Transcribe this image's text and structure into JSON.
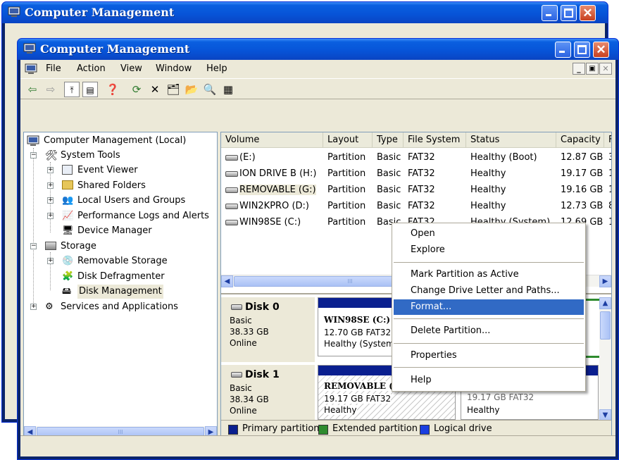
{
  "back_window": {
    "title": "Computer Management"
  },
  "window": {
    "title": "Computer Management",
    "menu": [
      "File",
      "Action",
      "View",
      "Window",
      "Help"
    ]
  },
  "tree": {
    "root": "Computer Management (Local)",
    "items": [
      "System Tools",
      "Event Viewer",
      "Shared Folders",
      "Local Users and Groups",
      "Performance Logs and Alerts",
      "Device Manager",
      "Storage",
      "Removable Storage",
      "Disk Defragmenter",
      "Disk Management",
      "Services and Applications"
    ]
  },
  "volumes": {
    "columns": [
      "Volume",
      "Layout",
      "Type",
      "File System",
      "Status",
      "Capacity",
      "F"
    ],
    "rows": [
      {
        "volume": "(E:)",
        "layout": "Partition",
        "type": "Basic",
        "fs": "FAT32",
        "status": "Healthy (Boot)",
        "capacity": "12.87 GB",
        "free": "3"
      },
      {
        "volume": "ION DRIVE B (H:)",
        "layout": "Partition",
        "type": "Basic",
        "fs": "FAT32",
        "status": "Healthy",
        "capacity": "19.17 GB",
        "free": "1"
      },
      {
        "volume": "REMOVABLE (G:)",
        "layout": "Partition",
        "type": "Basic",
        "fs": "FAT32",
        "status": "Healthy",
        "capacity": "19.16 GB",
        "free": "1"
      },
      {
        "volume": "WIN2KPRO (D:)",
        "layout": "Partition",
        "type": "Basic",
        "fs": "FAT32",
        "status": "Healthy",
        "capacity": "12.73 GB",
        "free": "8"
      },
      {
        "volume": "WIN98SE (C:)",
        "layout": "Partition",
        "type": "Basic",
        "fs": "FAT32",
        "status": "Healthy (System)",
        "capacity": "12.69 GB",
        "free": "1"
      }
    ]
  },
  "disks": [
    {
      "name": "Disk 0",
      "type": "Basic",
      "size": "38.33 GB",
      "state": "Online",
      "partition": {
        "name": "WIN98SE (C:)",
        "size": "12.70 GB FAT32",
        "status": "Healthy (System"
      }
    },
    {
      "name": "Disk 1",
      "type": "Basic",
      "size": "38.34 GB",
      "state": "Online",
      "partition": {
        "name": "REMOVABLE (",
        "size": "19.17 GB FAT32",
        "status": "Healthy"
      },
      "partition2": {
        "size": "19.17 GB FAT32",
        "status": "Healthy"
      }
    }
  ],
  "legend": [
    {
      "label": "Primary partition",
      "color": "#0a1f8f"
    },
    {
      "label": "Extended partition",
      "color": "#2e8b2e"
    },
    {
      "label": "Logical drive",
      "color": "#1a3ee0"
    }
  ],
  "context_menu": {
    "items": [
      "Open",
      "Explore",
      "Mark Partition as Active",
      "Change Drive Letter and Paths...",
      "Format...",
      "Delete Partition...",
      "Properties",
      "Help"
    ],
    "selected": "Format..."
  },
  "colors": {
    "title_bar": "#0753d7",
    "selection": "#316ac5"
  }
}
